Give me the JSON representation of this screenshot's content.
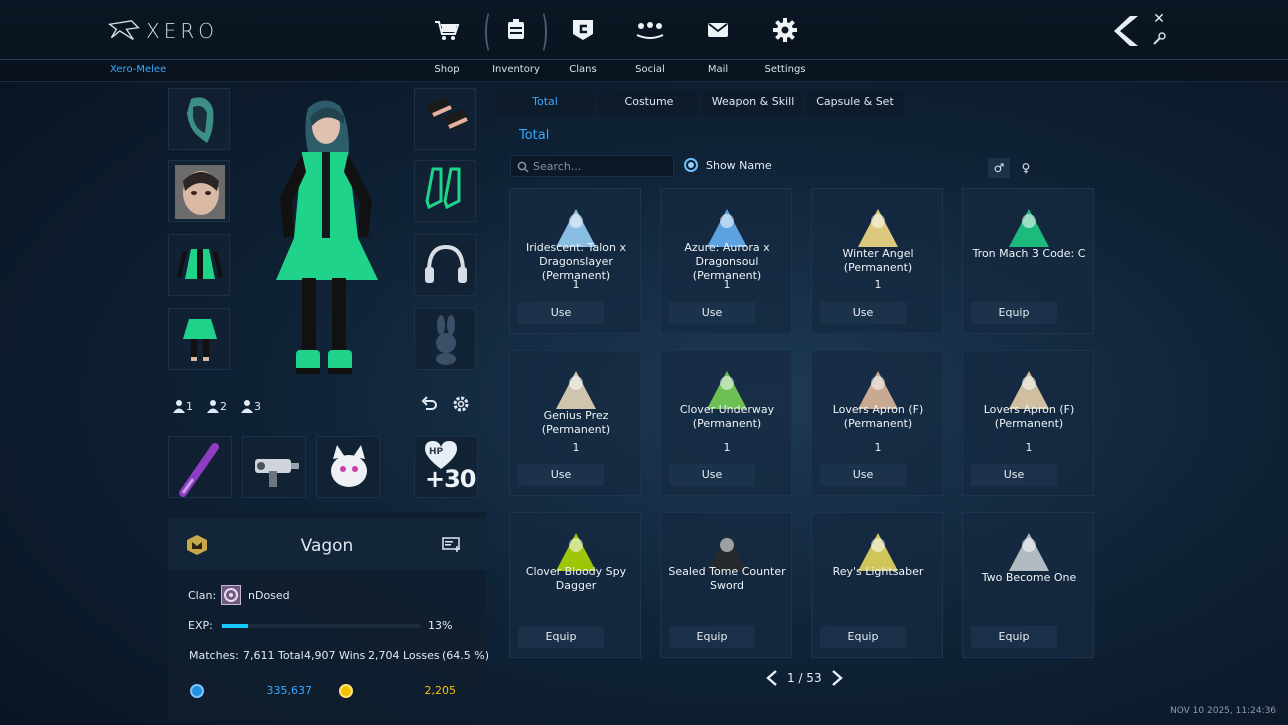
{
  "app": {
    "logo_text": "XERO",
    "mode": "Xero-Melee"
  },
  "nav": [
    {
      "label": "Shop",
      "icon": "cart-icon"
    },
    {
      "label": "Inventory",
      "icon": "inventory-icon"
    },
    {
      "label": "Clans",
      "icon": "clan-icon"
    },
    {
      "label": "Social",
      "icon": "social-icon"
    },
    {
      "label": "Mail",
      "icon": "mail-icon"
    },
    {
      "label": "Settings",
      "icon": "gear-icon"
    }
  ],
  "active_nav": "Inventory",
  "presets": [
    "1",
    "2",
    "3"
  ],
  "player": {
    "name": "Vagon",
    "clan_label": "Clan:",
    "clan_name": "nDosed",
    "exp_label": "EXP:",
    "exp_percent_text": "13%",
    "exp_fraction": 0.13,
    "matches_label": "Matches:",
    "total_text": "7,611 Total",
    "wins_text": "4,907 Wins",
    "losses_text": "2,704 Losses",
    "winrate_text": "(64.5 %)",
    "currency_blue": "335,637",
    "currency_gold": "2,205"
  },
  "hp_bonus": {
    "text": "+30",
    "badge": "HP"
  },
  "tabs": [
    "Total",
    "Costume",
    "Weapon & Skill",
    "Capsule & Set"
  ],
  "active_tab": "Total",
  "section_title": "Total",
  "search": {
    "placeholder": "Search..."
  },
  "show_name_label": "Show Name",
  "gender": [
    "♂",
    "♀"
  ],
  "items": [
    {
      "name": "Iridescent: Talon x Dragonslayer (Permanent)",
      "qty": "1",
      "action": "Use"
    },
    {
      "name": "Azure: Aurora x Dragonsoul (Permanent)",
      "qty": "1",
      "action": "Use"
    },
    {
      "name": "Winter Angel (Permanent)",
      "qty": "1",
      "action": "Use"
    },
    {
      "name": "Tron Mach 3 Code: C",
      "qty": "",
      "action": "Equip"
    },
    {
      "name": "Genius Prez (Permanent)",
      "qty": "1",
      "action": "Use"
    },
    {
      "name": "Clover Underway (Permanent)",
      "qty": "1",
      "action": "Use"
    },
    {
      "name": "Lovers Apron (F) (Permanent)",
      "qty": "1",
      "action": "Use"
    },
    {
      "name": "Lovers Apron (F) (Permanent)",
      "qty": "1",
      "action": "Use"
    },
    {
      "name": "Clover Bloody Spy Dagger",
      "qty": "",
      "action": "Equip"
    },
    {
      "name": "Sealed Tome Counter Sword",
      "qty": "",
      "action": "Equip"
    },
    {
      "name": "Rey's Lightsaber",
      "qty": "",
      "action": "Equip"
    },
    {
      "name": "Two Become One",
      "qty": "",
      "action": "Equip"
    }
  ],
  "pagination": {
    "text": "1 / 53",
    "current": 1,
    "total": 53
  },
  "timestamp": "NOV 10 2025, 11:24:36",
  "colors": {
    "accent": "#37a8ff",
    "exp": "#18c8ff",
    "costume_green": "#1fd48a",
    "gold": "#f2c200"
  }
}
